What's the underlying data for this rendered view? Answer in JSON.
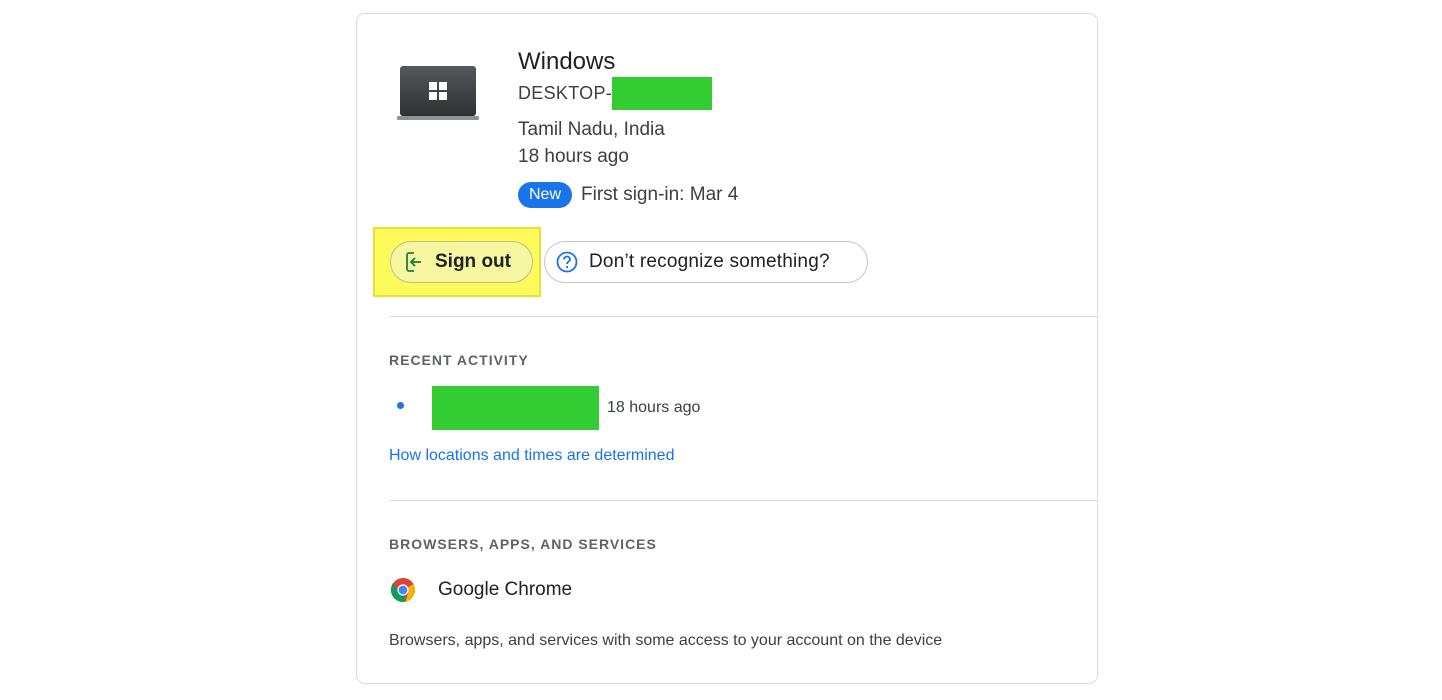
{
  "device": {
    "os_title": "Windows",
    "name_prefix": "DESKTOP-",
    "location": "Tamil Nadu, India",
    "last_seen": "18 hours ago",
    "badge": "New",
    "first_signin": "First sign-in: Mar 4",
    "icon": "windows-laptop-icon"
  },
  "actions": {
    "signout_label": "Sign out",
    "signout_icon": "sign-out-icon",
    "recognize_label": "Don’t recognize something?",
    "recognize_icon": "help-circle-icon",
    "highlight_color": "#fdfb5c"
  },
  "recent_activity": {
    "title": "RECENT ACTIVITY",
    "items": [
      {
        "time": "18 hours ago"
      }
    ],
    "link": "How locations and times are determined"
  },
  "apps": {
    "title": "BROWSERS, APPS, AND SERVICES",
    "items": [
      {
        "name": "Google Chrome",
        "icon": "chrome-icon"
      }
    ],
    "footnote": "Browsers, apps, and services with some access to your account on the device"
  },
  "colors": {
    "accent": "#1a73e8",
    "redaction": "#33cc33"
  }
}
